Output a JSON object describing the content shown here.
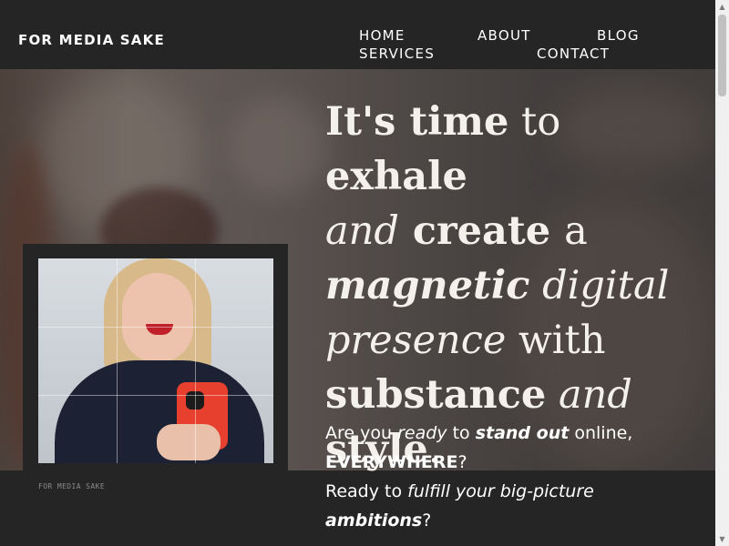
{
  "header": {
    "brand": "FOR MEDIA SAKE",
    "nav": {
      "home": "HOME",
      "about": "ABOUT",
      "blog": "BLOG",
      "services": "SERVICES",
      "contact": "CONTACT"
    }
  },
  "hero": {
    "headline": [
      [
        {
          "t": "It's time",
          "s": "b"
        },
        {
          "t": " to ",
          "s": ""
        },
        {
          "t": "exhale",
          "s": "b"
        }
      ],
      [
        {
          "t": "and",
          "s": "i"
        },
        {
          "t": " create ",
          "s": "b"
        },
        {
          "t": "a",
          "s": ""
        }
      ],
      [
        {
          "t": "magnetic",
          "s": "bi"
        },
        {
          "t": " digital",
          "s": "i"
        }
      ],
      [
        {
          "t": "presence",
          "s": "i"
        },
        {
          "t": " with",
          "s": ""
        }
      ],
      [
        {
          "t": "substance",
          "s": "b"
        },
        {
          "t": " and",
          "s": "i"
        }
      ],
      [
        {
          "t": "style",
          "s": "b"
        },
        {
          "t": ".",
          "s": ""
        }
      ]
    ],
    "sub1": [
      [
        {
          "t": "Are you ",
          "s": ""
        },
        {
          "t": "ready",
          "s": "i"
        },
        {
          "t": " to ",
          "s": ""
        },
        {
          "t": "stand out",
          "s": "bi"
        },
        {
          "t": " online,",
          "s": ""
        }
      ],
      [
        {
          "t": "EVERYWHERE",
          "s": "b"
        },
        {
          "t": "?",
          "s": ""
        }
      ]
    ],
    "sub2": [
      [
        {
          "t": "Ready to ",
          "s": ""
        },
        {
          "t": "fulfill your big-picture",
          "s": "i"
        }
      ],
      [
        {
          "t": "ambitions",
          "s": "bi"
        },
        {
          "t": "?",
          "s": ""
        }
      ]
    ],
    "photo_watermark": "FOR MEDIA SAKE"
  },
  "icons": {
    "scroll_up": "triangle-up",
    "scroll_down": "triangle-down"
  },
  "colors": {
    "header_bg": "#252525",
    "text": "#ffffff"
  }
}
